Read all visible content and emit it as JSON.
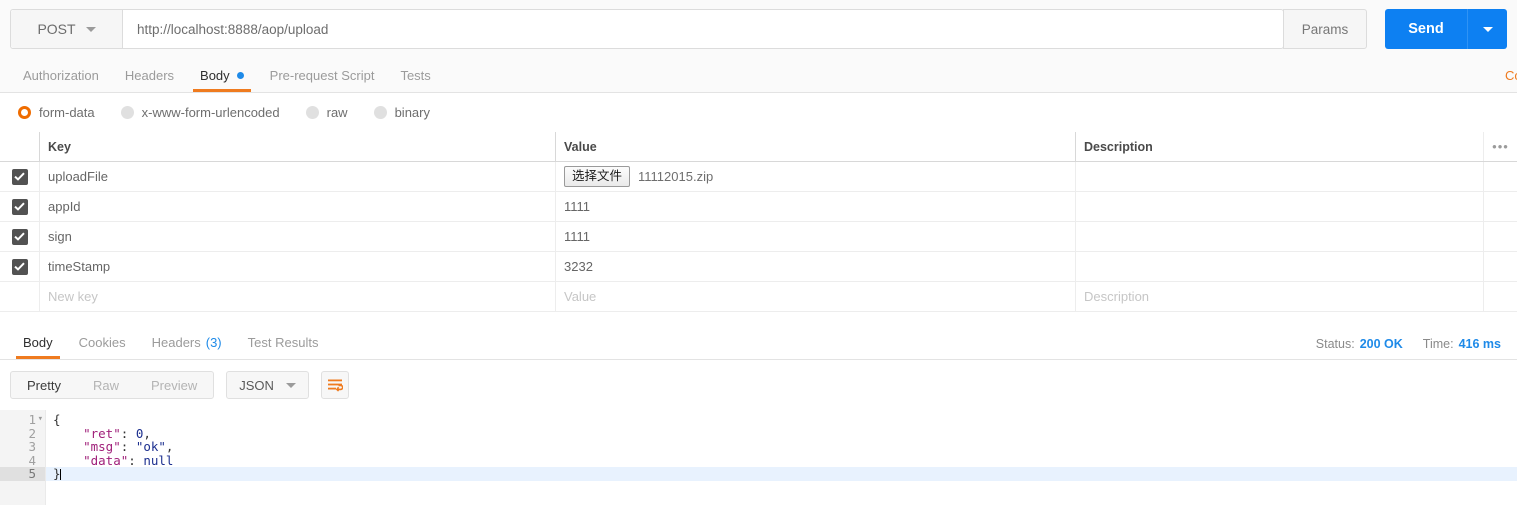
{
  "urlbar": {
    "method": "POST",
    "url": "http://localhost:8888/aop/upload",
    "params_label": "Params",
    "send_label": "Send"
  },
  "request_tabs": [
    {
      "label": "Authorization",
      "active": false
    },
    {
      "label": "Headers",
      "active": false
    },
    {
      "label": "Body",
      "active": true,
      "dot": true
    },
    {
      "label": "Pre-request Script",
      "active": false
    },
    {
      "label": "Tests",
      "active": false
    }
  ],
  "request_tabs_right": {
    "code_label": "Code"
  },
  "body_types": [
    {
      "label": "form-data",
      "selected": true
    },
    {
      "label": "x-www-form-urlencoded",
      "selected": false
    },
    {
      "label": "raw",
      "selected": false
    },
    {
      "label": "binary",
      "selected": false
    }
  ],
  "table": {
    "headers": {
      "key": "Key",
      "value": "Value",
      "description": "Description",
      "more": "•••"
    },
    "rows": [
      {
        "checked": true,
        "key": "uploadFile",
        "type": "file",
        "file_button": "选择文件",
        "file_name": "11112015.zip",
        "description": ""
      },
      {
        "checked": true,
        "key": "appId",
        "type": "text",
        "value": "1111",
        "description": ""
      },
      {
        "checked": true,
        "key": "sign",
        "type": "text",
        "value": "1111",
        "description": ""
      },
      {
        "checked": true,
        "key": "timeStamp",
        "type": "text",
        "value": "3232",
        "description": ""
      }
    ],
    "new_row": {
      "key_placeholder": "New key",
      "value_placeholder": "Value",
      "description_placeholder": "Description"
    }
  },
  "response_tabs": [
    {
      "label": "Body",
      "active": true
    },
    {
      "label": "Cookies",
      "active": false
    },
    {
      "label": "Headers",
      "active": false,
      "count": "(3)"
    },
    {
      "label": "Test Results",
      "active": false
    }
  ],
  "response_meta": {
    "status_label": "Status:",
    "status_value": "200 OK",
    "time_label": "Time:",
    "time_value": "416 ms"
  },
  "view_toolbar": {
    "modes": [
      {
        "label": "Pretty",
        "active": true
      },
      {
        "label": "Raw",
        "active": false
      },
      {
        "label": "Preview",
        "active": false
      }
    ],
    "format": "JSON",
    "wrap_icon": "wrap-lines-icon"
  },
  "response_body": {
    "language": "json",
    "lines": [
      {
        "num": "1",
        "foldable": true,
        "active": false,
        "tokens": [
          {
            "t": "p",
            "s": "{"
          }
        ]
      },
      {
        "num": "2",
        "foldable": false,
        "active": false,
        "tokens": [
          {
            "t": "p",
            "s": "    "
          },
          {
            "t": "k",
            "s": "\"ret\""
          },
          {
            "t": "p",
            "s": ": "
          },
          {
            "t": "v",
            "s": "0"
          },
          {
            "t": "p",
            "s": ","
          }
        ]
      },
      {
        "num": "3",
        "foldable": false,
        "active": false,
        "tokens": [
          {
            "t": "p",
            "s": "    "
          },
          {
            "t": "k",
            "s": "\"msg\""
          },
          {
            "t": "p",
            "s": ": "
          },
          {
            "t": "v",
            "s": "\"ok\""
          },
          {
            "t": "p",
            "s": ","
          }
        ]
      },
      {
        "num": "4",
        "foldable": false,
        "active": false,
        "tokens": [
          {
            "t": "p",
            "s": "    "
          },
          {
            "t": "k",
            "s": "\"data\""
          },
          {
            "t": "p",
            "s": ": "
          },
          {
            "t": "v",
            "s": "null"
          }
        ]
      },
      {
        "num": "5",
        "foldable": false,
        "active": true,
        "cursor": true,
        "tokens": [
          {
            "t": "p",
            "s": "}"
          }
        ]
      }
    ]
  },
  "colors": {
    "accent_orange": "#ef7b1f",
    "accent_blue": "#1e8ae8",
    "send_blue": "#0d80f2",
    "checkbox_gray": "#525252",
    "json_key": "#a0207a",
    "json_value": "#1c2f8f"
  }
}
